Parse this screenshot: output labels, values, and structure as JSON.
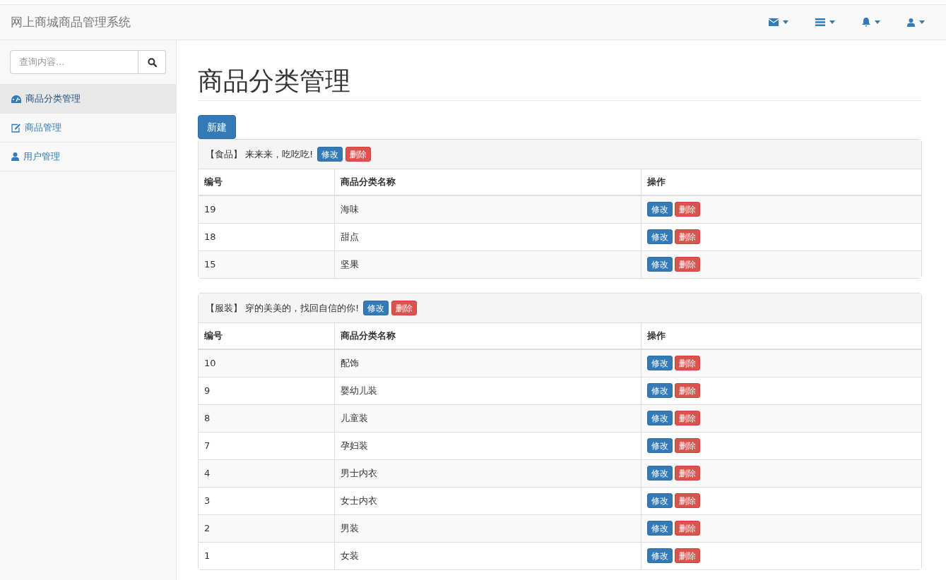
{
  "navbar": {
    "brand": "网上商城商品管理系统",
    "menus": [
      {
        "kind": "mail"
      },
      {
        "kind": "tasks"
      },
      {
        "kind": "bell"
      },
      {
        "kind": "user"
      }
    ]
  },
  "sidebar": {
    "search": {
      "placeholder": "查询内容..."
    },
    "items": [
      {
        "label": "商品分类管理",
        "selected": true
      },
      {
        "label": "商品管理",
        "selected": false
      },
      {
        "label": "用户管理",
        "selected": false
      }
    ]
  },
  "page": {
    "title": "商品分类管理",
    "new_button": "新建"
  },
  "panels": [
    {
      "name": "【食品】",
      "description": "来来来，吃吃吃!",
      "edit": "修改",
      "delete": "删除",
      "columns": [
        "编号",
        "商品分类名称",
        "操作"
      ],
      "rows": [
        {
          "id": "19",
          "name": "海味",
          "edit": "修改",
          "delete": "删除"
        },
        {
          "id": "18",
          "name": "甜点",
          "edit": "修改",
          "delete": "删除"
        },
        {
          "id": "15",
          "name": "坚果",
          "edit": "修改",
          "delete": "删除"
        }
      ]
    },
    {
      "name": "【服装】",
      "description": "穿的美美的，找回自信的你!",
      "edit": "修改",
      "delete": "删除",
      "columns": [
        "编号",
        "商品分类名称",
        "操作"
      ],
      "rows": [
        {
          "id": "10",
          "name": "配饰",
          "edit": "修改",
          "delete": "删除"
        },
        {
          "id": "9",
          "name": "婴幼儿装",
          "edit": "修改",
          "delete": "删除"
        },
        {
          "id": "8",
          "name": "儿童装",
          "edit": "修改",
          "delete": "删除"
        },
        {
          "id": "7",
          "name": "孕妇装",
          "edit": "修改",
          "delete": "删除"
        },
        {
          "id": "4",
          "name": "男士内衣",
          "edit": "修改",
          "delete": "删除"
        },
        {
          "id": "3",
          "name": "女士内衣",
          "edit": "修改",
          "delete": "删除"
        },
        {
          "id": "2",
          "name": "男装",
          "edit": "修改",
          "delete": "删除"
        },
        {
          "id": "1",
          "name": "女装",
          "edit": "修改",
          "delete": "删除"
        }
      ]
    }
  ]
}
